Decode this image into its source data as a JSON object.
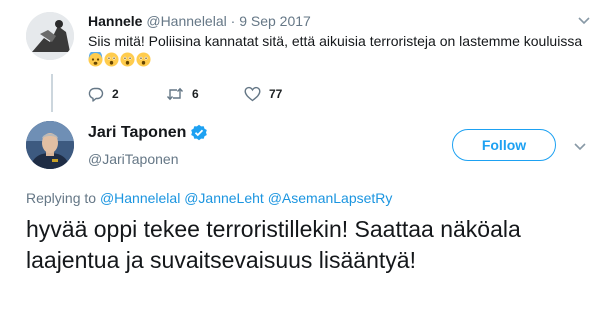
{
  "parent_tweet": {
    "name": "Hannele",
    "handle": "@Hannelelal",
    "separator": "·",
    "date": "9 Sep 2017",
    "text": "Siis mitä! Poliisina kannatat sitä, että aikuisia terroristeja on lastemme kouluissa",
    "emojis": [
      "fearful-face",
      "astonished-face",
      "astonished-face",
      "astonished-face"
    ],
    "reply_count": "2",
    "retweet_count": "6",
    "like_count": "77"
  },
  "main_tweet": {
    "name": "Jari Taponen",
    "handle": "@JariTaponen",
    "follow_label": "Follow",
    "replying_prefix": "Replying to",
    "replying_to": [
      "@Hannelelal",
      "@JanneLeht",
      "@AsemanLapsetRy"
    ],
    "text": "hyvää oppi tekee terroristillekin! Saattaa näköala laajentua ja suvaitsevaisuus lisääntyä!"
  },
  "colors": {
    "accent": "#1da1f2",
    "link": "#1b95e0",
    "muted": "#657786",
    "text": "#14171a",
    "verified": "#1da1f2"
  }
}
